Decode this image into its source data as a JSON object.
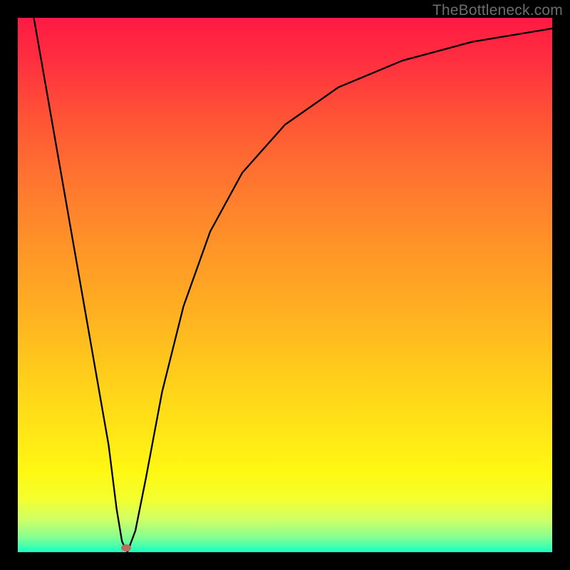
{
  "watermark": {
    "text": "TheBottleneck.com"
  },
  "chart_data": {
    "type": "line",
    "title": "",
    "xlabel": "",
    "ylabel": "",
    "x_range": [
      0,
      100
    ],
    "y_range": [
      0,
      100
    ],
    "gradient_meaning": "bottleneck severity (red=high, green=low)",
    "series": [
      {
        "name": "bottleneck-curve",
        "x": [
          3,
          6.5,
          10,
          13.5,
          17,
          18.5,
          19.5,
          20.5,
          22,
          24,
          27,
          31,
          36,
          42,
          50,
          60,
          72,
          85,
          100
        ],
        "values": [
          100,
          80,
          60,
          40,
          20,
          8,
          2,
          0,
          4,
          14,
          30,
          46,
          60,
          71,
          80,
          87,
          92,
          95.5,
          98
        ]
      }
    ],
    "marker": {
      "x": 20.2,
      "y": 0.8,
      "meaning": "optimal / zero-bottleneck point"
    },
    "annotations": []
  }
}
